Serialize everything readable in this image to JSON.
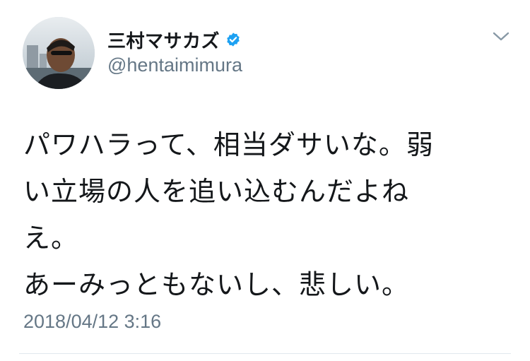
{
  "user": {
    "display_name": "三村マサカズ",
    "handle": "@hentaimimura",
    "verified": true,
    "avatar_icon": "user-avatar-photo"
  },
  "tweet": {
    "lines": [
      "パワハラって、相当ダサいな。弱",
      "い立場の人を追い込むんだよね",
      "え。",
      "あーみっともないし、悲しい。"
    ],
    "timestamp": "2018/04/12 3:16"
  },
  "icons": {
    "menu": "chevron-down-icon",
    "verified": "verified-badge-icon"
  },
  "colors": {
    "verified_blue": "#1da1f2",
    "secondary_text": "#657786",
    "primary_text": "#14171a",
    "divider": "#e1e8ed"
  }
}
